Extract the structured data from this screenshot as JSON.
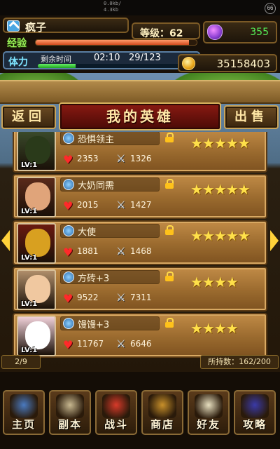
{
  "status_bar": {
    "net_up": "0.0kb/",
    "net_down": "4.3kb",
    "battery": "66"
  },
  "player": {
    "name": "疯子",
    "level_text": "等级：62",
    "exp_label": "经验",
    "exp_progress": 0.95,
    "stamina_label": "体力",
    "stamina_timer_label": "剩余时间",
    "stamina_timer": "02:10",
    "stamina_count": "29/123",
    "stamina_progress": 0.24,
    "gems": "355",
    "gold": "35158403"
  },
  "header": {
    "back_label": "返回",
    "title": "我的英雄",
    "sell_label": "出售"
  },
  "heroes": [
    {
      "name": "恐惧领主",
      "level": "LV:1",
      "hp": "2353",
      "atk": "1326",
      "stars": "★★★★★",
      "portrait_color": "#3a4a2a",
      "face_color": "#2a3a1a"
    },
    {
      "name": "大奶同需",
      "level": "LV:1",
      "hp": "2015",
      "atk": "1427",
      "stars": "★★★★★",
      "portrait_color": "#5a2a1a",
      "face_color": "#e0a47a"
    },
    {
      "name": "大使",
      "level": "LV:1",
      "hp": "1881",
      "atk": "1468",
      "stars": "★★★★★",
      "portrait_color": "#6a1a10",
      "face_color": "#d8a020"
    },
    {
      "name": "方砖+3",
      "level": "LV:1",
      "hp": "9522",
      "atk": "7311",
      "stars": "★★★★",
      "portrait_color": "#b08e6a",
      "face_color": "#f0c8a0"
    },
    {
      "name": "馒馒+3",
      "level": "LV:1",
      "hp": "11767",
      "atk": "6646",
      "stars": "★★★★",
      "portrait_color": "#f0d0d8",
      "face_color": "#ffffff"
    }
  ],
  "footer": {
    "page": "2/9",
    "capacity": "所持数：162/200"
  },
  "bottom_nav": [
    {
      "label": "主页",
      "icon": "house-icon",
      "color": "#4a7ac0"
    },
    {
      "label": "副本",
      "icon": "skull-icon",
      "color": "#c8b890"
    },
    {
      "label": "战斗",
      "icon": "target-icon",
      "color": "#d83a2a"
    },
    {
      "label": "商店",
      "icon": "shop-icon",
      "color": "#c8902a"
    },
    {
      "label": "好友",
      "icon": "wings-icon",
      "color": "#e8e0c0"
    },
    {
      "label": "攻略",
      "icon": "wizard-hat-icon",
      "color": "#3a3aa8"
    }
  ]
}
